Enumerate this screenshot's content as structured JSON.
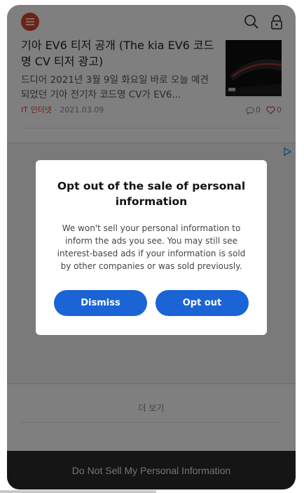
{
  "header": {
    "menu_icon": "hamburger-menu-icon",
    "search_icon": "search-icon",
    "lock_icon": "lock-icon",
    "accent": "#d8442c"
  },
  "article": {
    "title": "기아 EV6 티저 공개 (The kia EV6 코드명 CV 티저 광고)",
    "excerpt": "드디어 2021년 3월 9일 화요일 바로 오늘 예견되었던 기아 전기차 코드명 CV가 EV6...",
    "category": "IT 인터넷",
    "separator": "·",
    "date": "2021.03.09",
    "comment_count": "0",
    "like_count": "0"
  },
  "more_label": "더 보기",
  "footer": {
    "link": "Do Not Sell My Personal Information"
  },
  "modal": {
    "title": "Opt out of the sale of personal information",
    "body": "We won't sell your personal information to inform the ads you see. You may still see interest-based ads if your information is sold by other companies or was sold previously.",
    "dismiss_label": "Dismiss",
    "optout_label": "Opt out",
    "button_color": "#1a64d6"
  }
}
